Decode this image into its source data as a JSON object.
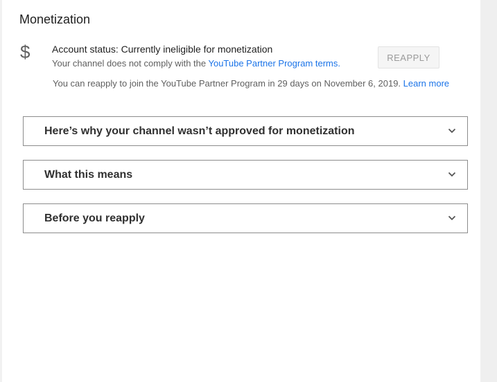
{
  "section": {
    "title": "Monetization"
  },
  "status": {
    "icon": "dollar-icon",
    "dollar_glyph": "$",
    "account_status": "Account status: Currently ineligible for monetization",
    "compliance_prefix": "Your channel does not comply with the ",
    "compliance_link": "YouTube Partner Program terms.",
    "reapply_button_label": "REAPPLY",
    "reapply_info_text": "You can reapply to join the YouTube Partner Program in 29 days on November 6, 2019.",
    "learn_more_label": "Learn more"
  },
  "accordions": [
    {
      "label": "Here’s why your channel wasn’t approved for monetization",
      "icon": "chevron-down-icon"
    },
    {
      "label": "What this means",
      "icon": "chevron-down-icon"
    },
    {
      "label": "Before you reapply",
      "icon": "chevron-down-icon"
    }
  ],
  "colors": {
    "link": "#1a73e8",
    "border": "#8c8c8c",
    "muted_text": "#606060"
  }
}
